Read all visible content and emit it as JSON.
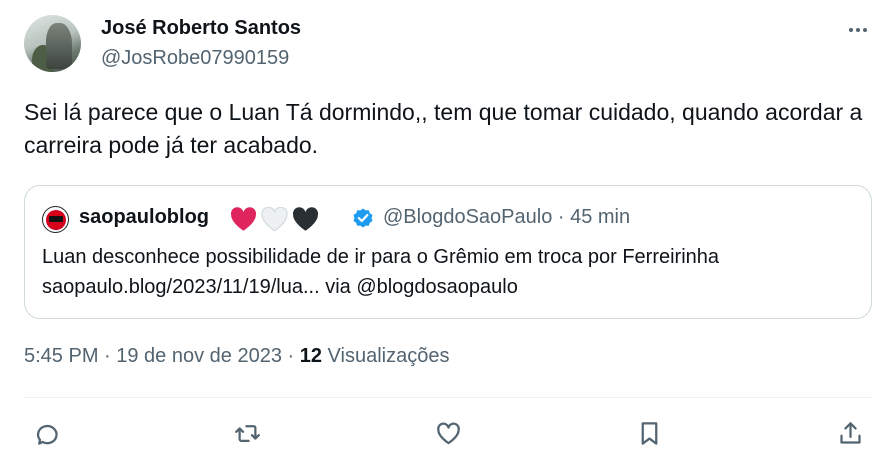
{
  "author": {
    "name": "José Roberto Santos",
    "handle": "@JosRobe07990159"
  },
  "tweet": {
    "text": "Sei lá parece que o Luan Tá dormindo,, tem que tomar cuidado, quando acordar a carreira pode já ter acabado."
  },
  "quoted": {
    "name": "saopauloblog",
    "hearts": [
      "red-heart",
      "white-heart",
      "black-heart"
    ],
    "verified": true,
    "handle_time": "@BlogdoSaoPaulo · 45 min",
    "text_line1": "Luan desconhece possibilidade de ir para o Grêmio em troca por Ferreirinha",
    "text_line2": "saopaulo.blog/2023/11/19/lua... via @blogdosaopaulo"
  },
  "meta": {
    "timestamp": "5:45 PM · 19 de nov de 2023 · ",
    "views_count": "12",
    "views_label": "Visualizações"
  },
  "actions": [
    "reply-icon",
    "retweet-icon",
    "like-icon",
    "bookmark-icon",
    "share-icon"
  ],
  "colors": {
    "text_primary": "#0f1419",
    "text_secondary": "#536471",
    "border": "#cfd9de",
    "verified": "#1d9bf0",
    "heart_red": "#e0245e",
    "brand_red": "#d6001c"
  }
}
